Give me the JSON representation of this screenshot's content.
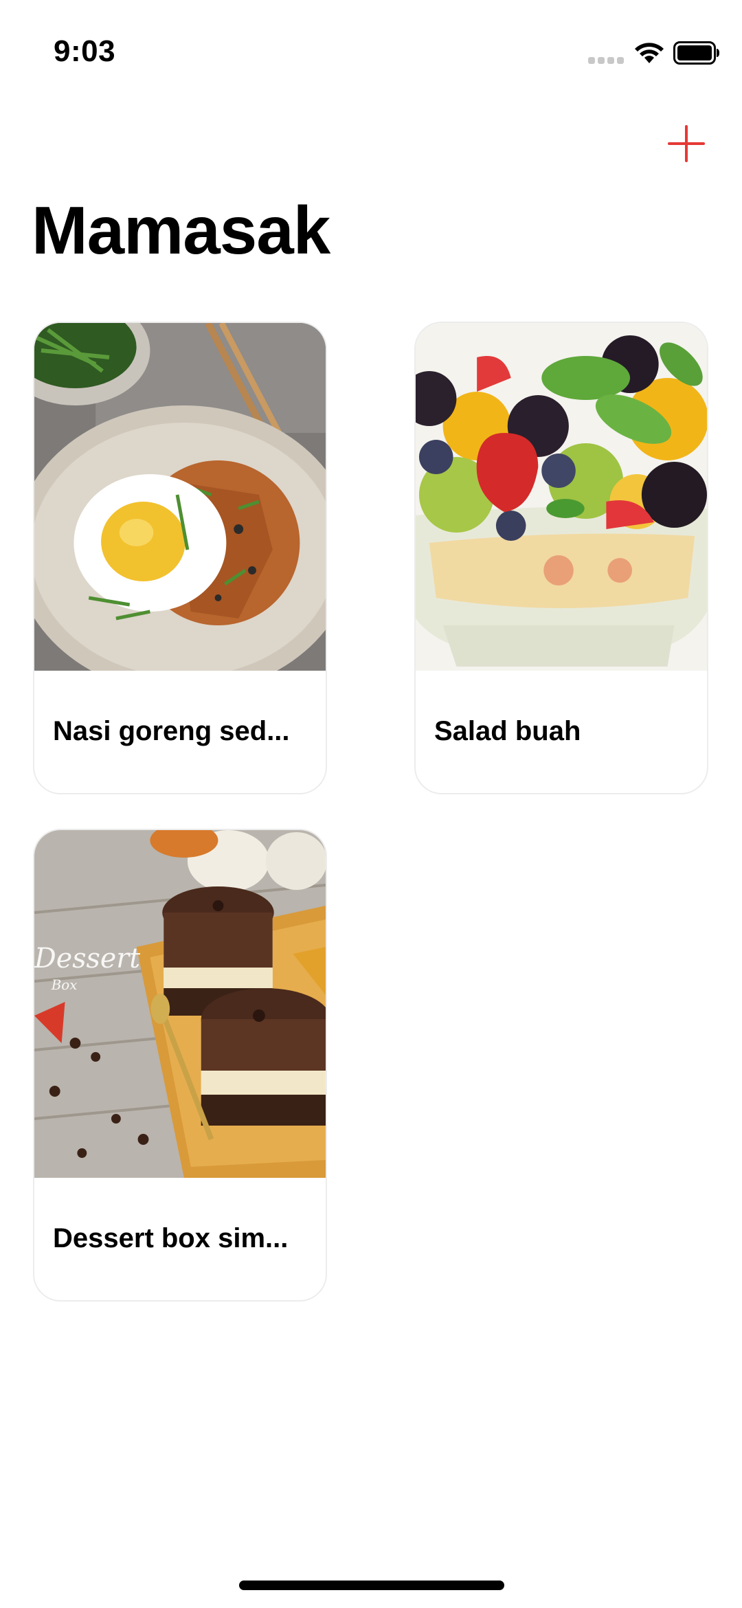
{
  "status_bar": {
    "time": "9:03",
    "icons": [
      "cellular-signal-icon",
      "wifi-icon",
      "battery-icon"
    ]
  },
  "header": {
    "add_icon": "plus-icon",
    "title": "Mamasak",
    "accent_color": "#e53935"
  },
  "recipes": [
    {
      "title": "Nasi goreng sed...",
      "image": "fried-rice-with-egg-photo"
    },
    {
      "title": "Salad buah",
      "image": "fruit-salad-photo"
    },
    {
      "title": "Dessert box sim...",
      "image": "chocolate-dessert-box-photo"
    }
  ]
}
